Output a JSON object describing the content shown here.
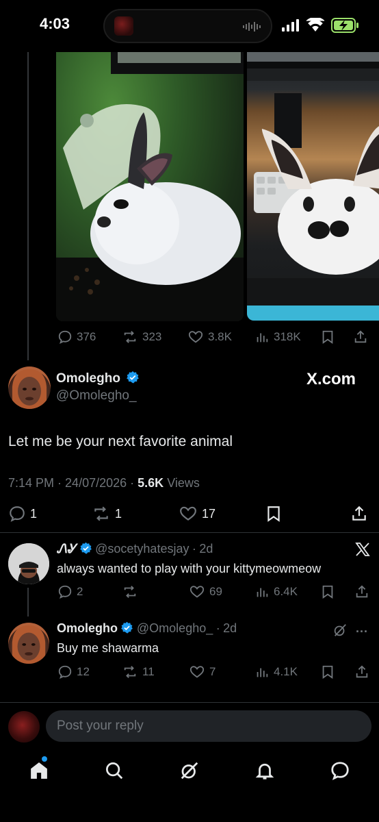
{
  "status_bar": {
    "time": "4:03"
  },
  "thread_stats": {
    "replies": "376",
    "reposts": "323",
    "likes": "3.8K",
    "views": "318K"
  },
  "main_tweet": {
    "name": "Omolegho",
    "handle": "@Omolegho_",
    "watermark": "X.com",
    "text": "Let me be your next favorite animal",
    "time": "7:14 PM",
    "date": "24/07/2026",
    "views_count": "5.6K",
    "views_label": "Views",
    "replies": "1",
    "reposts": "1",
    "likes": "17"
  },
  "replies": [
    {
      "name": "ᏁᎽ",
      "handle": "@socetyhatesjay",
      "age": "2d",
      "text": "always wanted to play with your kittymeowmeow",
      "replies": "2",
      "reposts": "",
      "likes": "69",
      "views": "6.4K"
    },
    {
      "name": "Omolegho",
      "handle": "@Omolegho_",
      "age": "2d",
      "text": "Buy me shawarma",
      "replies": "12",
      "reposts": "11",
      "likes": "7",
      "views": "4.1K"
    }
  ],
  "reply_box": {
    "placeholder": "Post your reply"
  },
  "colors": {
    "background": "#000000",
    "verified": "#1d9bf0",
    "muted": "#71767b",
    "text": "#e7e9ea"
  }
}
